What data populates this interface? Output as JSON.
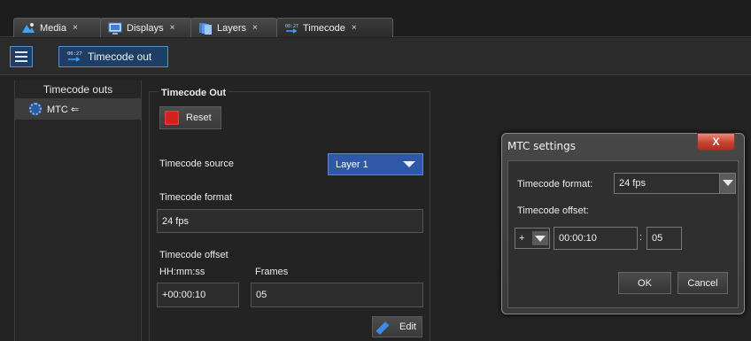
{
  "tabs": [
    {
      "label": "Media",
      "icon": "media-icon",
      "close": "×"
    },
    {
      "label": "Displays",
      "icon": "display-icon",
      "close": "×"
    },
    {
      "label": "Layers",
      "icon": "layers-icon",
      "close": "×"
    },
    {
      "label": "Timecode",
      "icon": "timecode-icon",
      "close": "×"
    }
  ],
  "toolbar": {
    "timecode_out_label": "Timecode out",
    "icon_text_top": "00:27"
  },
  "left_panel": {
    "header": "Timecode outs",
    "items": [
      {
        "label": "MTC ⇐"
      }
    ]
  },
  "timecode_out": {
    "group_title": "Timecode Out",
    "reset_label": "Reset",
    "source_label": "Timecode source",
    "source_value": "Layer 1",
    "format_label": "Timecode format",
    "format_value": "24 fps",
    "offset_label": "Timecode offset",
    "hhmmss_label": "HH:mm:ss",
    "frames_label": "Frames",
    "offset_time_value": "+00:00:10",
    "offset_frames_value": "05",
    "edit_label": "Edit"
  },
  "dialog": {
    "title": "MTC settings",
    "close_label": "X",
    "format_label": "Timecode format:",
    "format_value": "24 fps",
    "offset_label": "Timecode offset:",
    "sign_value": "+",
    "time_value": "00:00:10",
    "separator": ":",
    "frames_value": "05",
    "ok_label": "OK",
    "cancel_label": "Cancel"
  },
  "colors": {
    "accent": "#2f58a8",
    "reset_red": "#d62020",
    "close_red": "#c44432"
  }
}
